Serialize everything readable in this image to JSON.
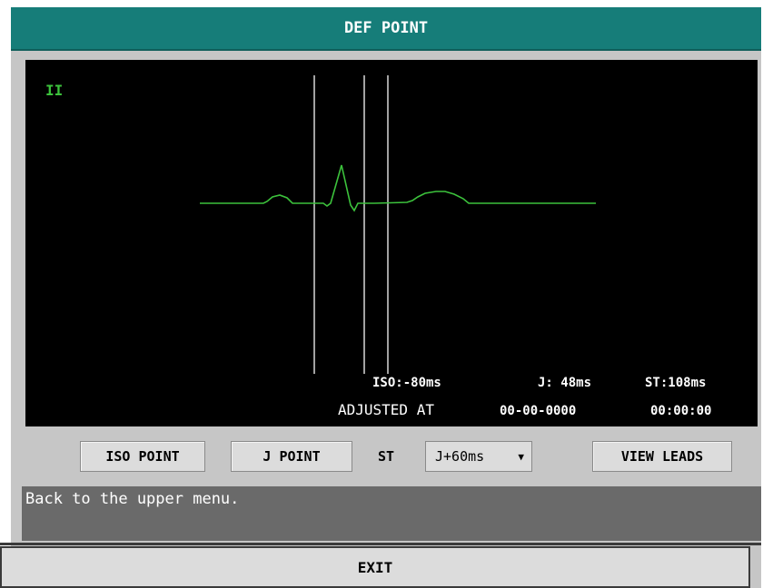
{
  "window": {
    "title": "DEF POINT"
  },
  "ecg": {
    "lead": "II",
    "waveform_color": "#3cc23c",
    "iso": "ISO:-80ms",
    "j": "J: 48ms",
    "st": "ST:108ms",
    "adjusted_label": "ADJUSTED AT",
    "adjusted_date": "00-00-0000",
    "adjusted_time": "00:00:00"
  },
  "controls": {
    "iso_button": "ISO POINT",
    "j_button": "J POINT",
    "st_label": "ST",
    "st_select": {
      "selected": "J+60ms",
      "icon": "dropdown-arrow-icon"
    },
    "view_leads_button": "VIEW LEADS"
  },
  "help_text": "Back to the upper menu.",
  "exit_button": "EXIT",
  "colors": {
    "title_bar": "#167d79",
    "dialog_bg": "#c6c6c6",
    "ecg_bg": "#000000",
    "help_bg": "#6a6a6a"
  }
}
